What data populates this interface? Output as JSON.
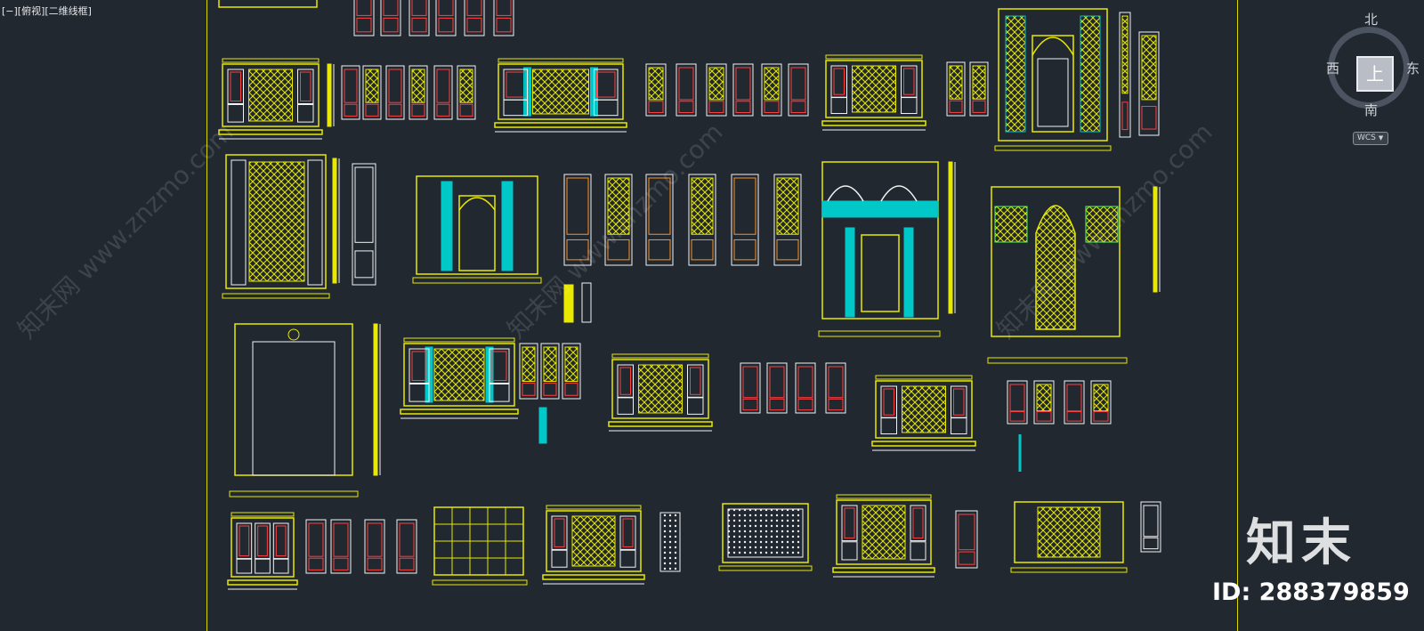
{
  "viewport": {
    "label": "[−][俯视][二维线框]"
  },
  "viewcube": {
    "north": "北",
    "south": "南",
    "west": "西",
    "east": "东",
    "top_face": "上",
    "wcs_label": "WCS"
  },
  "watermark": {
    "logo_text": "知末",
    "id_text": "ID: 288379859",
    "diagonal_text": "知末网 www.znzmo.com"
  },
  "colors": {
    "background": "#212830",
    "yellow": "#e8e800",
    "white": "#f2f2f2",
    "red": "#ff4040",
    "cyan": "#00c8c8",
    "magenta": "#ff60c0",
    "orange": "#ff9020",
    "green": "#50ff50",
    "boundary": "#d9d900"
  }
}
